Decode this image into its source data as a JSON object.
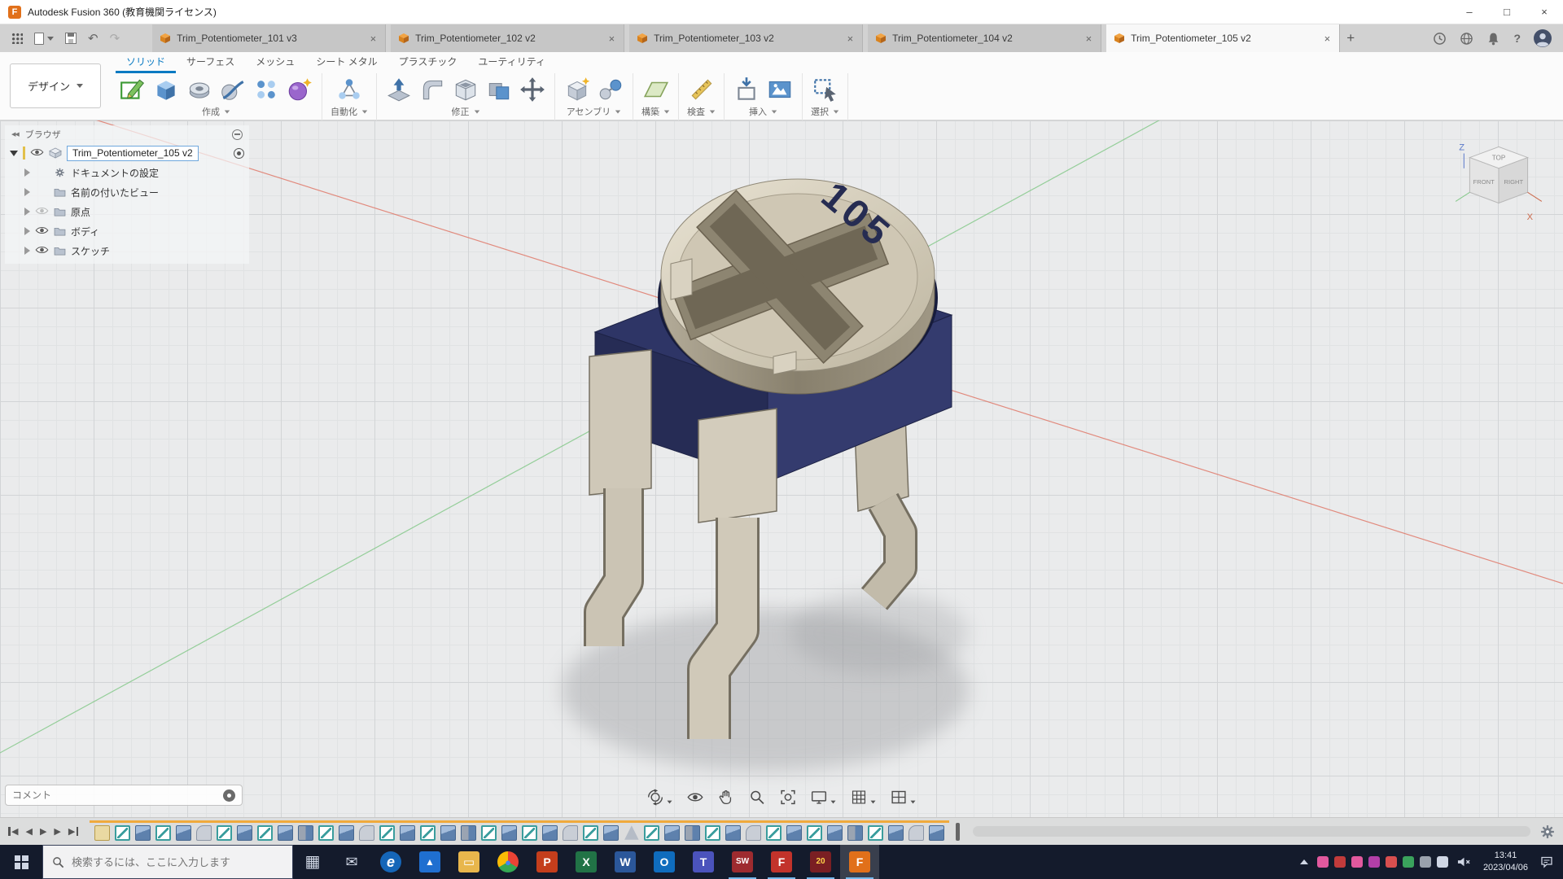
{
  "titlebar": {
    "logo_glyph": "F",
    "app_title": "Autodesk Fusion 360 (教育機関ライセンス)",
    "minimize_glyph": "–",
    "maximize_glyph": "□",
    "close_glyph": "×"
  },
  "quick_access": {
    "undo_glyph": "↶",
    "redo_glyph": "↷"
  },
  "tabbar": {
    "close_glyph": "×",
    "new_tab_glyph": "+",
    "help_glyph": "?",
    "tabs": [
      {
        "label": "Trim_Potentiometer_101 v3",
        "state": ""
      },
      {
        "label": "Trim_Potentiometer_102 v2",
        "state": ""
      },
      {
        "label": "Trim_Potentiometer_103 v2",
        "state": ""
      },
      {
        "label": "Trim_Potentiometer_104 v2",
        "state": ""
      },
      {
        "label": "Trim_Potentiometer_105 v2",
        "state": "active"
      }
    ]
  },
  "ribbon": {
    "workspace": "デザイン",
    "tabs": [
      {
        "label": "ソリッド",
        "state": "active"
      },
      {
        "label": "サーフェス",
        "state": ""
      },
      {
        "label": "メッシュ",
        "state": ""
      },
      {
        "label": "シート メタル",
        "state": ""
      },
      {
        "label": "プラスチック",
        "state": ""
      },
      {
        "label": "ユーティリティ",
        "state": ""
      }
    ],
    "groups": [
      {
        "label": "作成",
        "icons": [
          {
            "dn": "create-sketch-button",
            "ref": "#ic-sketch"
          },
          {
            "dn": "extrude-button",
            "ref": "#ic-extrude"
          },
          {
            "dn": "revolve-button",
            "ref": "#ic-revolve"
          },
          {
            "dn": "sweep-button",
            "ref": "#ic-sweep"
          },
          {
            "dn": "pattern-button",
            "ref": "#ic-pattern"
          },
          {
            "dn": "create-form-button",
            "ref": "#ic-form"
          }
        ]
      },
      {
        "label": "自動化",
        "icons": [
          {
            "dn": "automate-button",
            "ref": "#ic-script"
          }
        ]
      },
      {
        "label": "修正",
        "icons": [
          {
            "dn": "press-pull-button",
            "ref": "#ic-presspull"
          },
          {
            "dn": "fillet-button",
            "ref": "#ic-fillet"
          },
          {
            "dn": "shell-button",
            "ref": "#ic-shell"
          },
          {
            "dn": "combine-button",
            "ref": "#ic-combine"
          },
          {
            "dn": "move-copy-button",
            "ref": "#ic-move"
          }
        ]
      },
      {
        "label": "アセンブリ",
        "icons": [
          {
            "dn": "new-component-button",
            "ref": "#ic-component"
          },
          {
            "dn": "joint-button",
            "ref": "#ic-joint"
          }
        ]
      },
      {
        "label": "構築",
        "icons": [
          {
            "dn": "construction-plane-button",
            "ref": "#ic-plane"
          }
        ]
      },
      {
        "label": "検査",
        "icons": [
          {
            "dn": "measure-button",
            "ref": "#ic-measure"
          }
        ]
      },
      {
        "label": "挿入",
        "icons": [
          {
            "dn": "insert-button",
            "ref": "#ic-insert"
          },
          {
            "dn": "canvas-button",
            "ref": "#ic-canvas"
          }
        ]
      },
      {
        "label": "選択",
        "icons": [
          {
            "dn": "select-button",
            "ref": "#ic-select"
          }
        ]
      }
    ]
  },
  "browser": {
    "panel_title": "ブラウザ",
    "collapse_glyph": "◀◀",
    "root_label": "Trim_Potentiometer_105 v2",
    "items": [
      {
        "label": "ドキュメントの設定",
        "icon": "gear",
        "eye": "none"
      },
      {
        "label": "名前の付いたビュー",
        "icon": "folder",
        "eye": "none"
      },
      {
        "label": "原点",
        "icon": "folder",
        "eye": "off"
      },
      {
        "label": "ボディ",
        "icon": "folder",
        "eye": "on"
      },
      {
        "label": "スケッチ",
        "icon": "folder",
        "eye": "on"
      }
    ]
  },
  "viewcube": {
    "top": "TOP",
    "front": "FRONT",
    "right": "RIGHT",
    "z": "Z",
    "x": "X"
  },
  "scene": {
    "marking": "105",
    "body_color": "#2e3566",
    "metal_color": "#cfc8b8",
    "axis_x_color": "#e07a6a",
    "axis_y_color": "#86c98b"
  },
  "comment": {
    "placeholder": "コメント"
  },
  "navbar": {
    "items": [
      {
        "dn": "orbit-button",
        "ref": "#nv-orbit",
        "caret": "with-caret"
      },
      {
        "dn": "look-at-button",
        "ref": "#nv-lookat",
        "caret": ""
      },
      {
        "dn": "pan-button",
        "ref": "#nv-pan",
        "caret": ""
      },
      {
        "dn": "zoom-button",
        "ref": "#nv-zoom",
        "caret": ""
      },
      {
        "dn": "fit-button",
        "ref": "#nv-fit",
        "caret": ""
      },
      {
        "dn": "display-settings-button",
        "ref": "#nv-display",
        "caret": "with-caret"
      },
      {
        "dn": "grid-and-snaps-button",
        "ref": "#nv-grid",
        "caret": "with-caret"
      },
      {
        "dn": "viewports-button",
        "ref": "#nv-views",
        "caret": "with-caret"
      }
    ]
  },
  "timeline": {
    "controls": [
      {
        "dn": "go-to-start-button",
        "glyph": "◀",
        "bar": "bar-left"
      },
      {
        "dn": "step-back-button",
        "glyph": "◀",
        "bar": ""
      },
      {
        "dn": "play-button",
        "glyph": "▶",
        "bar": ""
      },
      {
        "dn": "step-forward-button",
        "glyph": "▶",
        "bar": ""
      },
      {
        "dn": "go-to-end-button",
        "glyph": "▶",
        "bar": "bar-right"
      }
    ],
    "features": [
      "component",
      "sketch",
      "extrude",
      "sketch",
      "extrude",
      "fillet",
      "sketch",
      "extrude",
      "sketch",
      "extrude",
      "combine",
      "sketch",
      "extrude",
      "fillet",
      "sketch",
      "extrude",
      "sketch",
      "extrude",
      "combine",
      "sketch",
      "extrude",
      "sketch",
      "extrude",
      "fillet",
      "sketch",
      "extrude",
      "mesh",
      "sketch",
      "extrude",
      "combine",
      "sketch",
      "extrude",
      "fillet",
      "sketch",
      "extrude",
      "sketch",
      "extrude",
      "combine",
      "sketch",
      "extrude",
      "fillet",
      "extrude"
    ]
  },
  "taskbar": {
    "search_placeholder": "検索するには、ここに入力します",
    "apps": [
      {
        "dn": "taskbar-task-view",
        "glyph": "▦",
        "style": "color:#cfd6e4;font-size:20px"
      },
      {
        "dn": "taskbar-mail",
        "glyph": "✉",
        "style": "color:#cfd6e4;font-size:18px"
      },
      {
        "dn": "taskbar-edge",
        "glyph": "e",
        "style": "background:#1566b8;color:#fff;border-radius:50%;font-style:italic;font-size:18px"
      },
      {
        "dn": "taskbar-photos",
        "glyph": "▲",
        "style": "background:#1f6fd0;color:#fff;font-size:12px"
      },
      {
        "dn": "taskbar-file-explorer",
        "glyph": "▭",
        "style": "background:#e8b64c;color:#fff;font-size:15px"
      },
      {
        "dn": "taskbar-chrome",
        "glyph": "●",
        "style": "background:conic-gradient(#ea4335 0deg 120deg,#34a853 120deg 240deg,#fbbc05 240deg 360deg);color:#4285f4;border-radius:50%;font-size:13px"
      },
      {
        "dn": "taskbar-powerpoint",
        "glyph": "P",
        "style": "background:#c43e1c;color:#fff"
      },
      {
        "dn": "taskbar-excel",
        "glyph": "X",
        "style": "background:#217346;color:#fff"
      },
      {
        "dn": "taskbar-word",
        "glyph": "W",
        "style": "background:#2b579a;color:#fff"
      },
      {
        "dn": "taskbar-outlook",
        "glyph": "O",
        "style": "background:#0f6cbd;color:#fff"
      },
      {
        "dn": "taskbar-teams",
        "glyph": "T",
        "style": "background:#4b53bc;color:#fff"
      },
      {
        "dn": "taskbar-solidworks-2019",
        "glyph": "SW",
        "style": "background:#9e2b2f;color:#fff;font-size:10px",
        "state": "running"
      },
      {
        "dn": "taskbar-app-f",
        "glyph": "F",
        "style": "background:#c2332b;color:#fff",
        "state": "running"
      },
      {
        "dn": "taskbar-solidworks-2020",
        "glyph": "20",
        "style": "background:#7a1f23;color:#ffd24a;font-size:10px",
        "state": "running"
      },
      {
        "dn": "taskbar-fusion-360",
        "glyph": "F",
        "style": "background:#e1701a;color:#fff",
        "state": "active"
      }
    ],
    "tray_icons": [
      "background:#e2599e",
      "background:#c23b3b",
      "background:#e2599e",
      "background:#b33fa8",
      "background:#d94f4f",
      "background:#3aa35c",
      "background:#9aa2ad",
      "background:#cfd6e4"
    ],
    "clock": {
      "time": "13:41",
      "date": "2023/04/06"
    }
  }
}
